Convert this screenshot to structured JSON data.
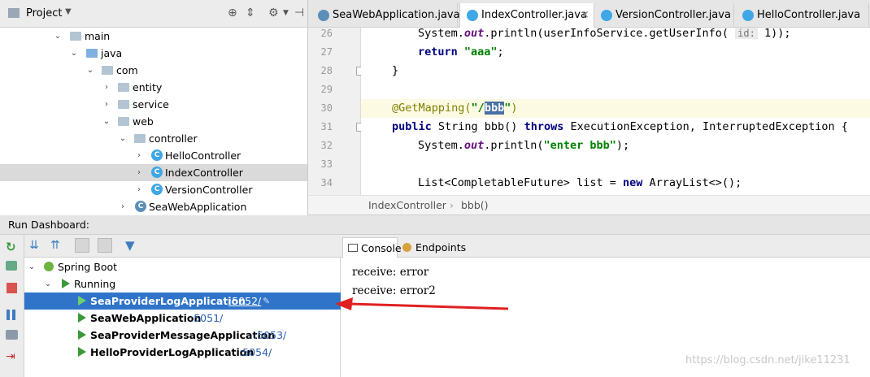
{
  "project": {
    "title": "Project",
    "tree": [
      {
        "label": "main",
        "type": "folder",
        "expanded": true
      },
      {
        "label": "java",
        "type": "folder-blue",
        "expanded": true
      },
      {
        "label": "com",
        "type": "package",
        "expanded": true
      },
      {
        "label": "entity",
        "type": "package",
        "expanded": false
      },
      {
        "label": "service",
        "type": "package",
        "expanded": false
      },
      {
        "label": "web",
        "type": "package",
        "expanded": true
      },
      {
        "label": "controller",
        "type": "package",
        "expanded": true
      },
      {
        "label": "HelloController",
        "type": "class",
        "expanded": false
      },
      {
        "label": "IndexController",
        "type": "class",
        "expanded": false,
        "selected": true
      },
      {
        "label": "VersionController",
        "type": "class",
        "expanded": false
      },
      {
        "label": "SeaWebApplication",
        "type": "spring-class",
        "expanded": false
      }
    ]
  },
  "tabs": [
    {
      "label": "SeaWebApplication.java",
      "active": false
    },
    {
      "label": "IndexController.java",
      "active": true
    },
    {
      "label": "VersionController.java",
      "active": false
    },
    {
      "label": "HelloController.java",
      "active": false
    }
  ],
  "editor": {
    "lines": [
      {
        "num": "26"
      },
      {
        "num": "27"
      },
      {
        "num": "28"
      },
      {
        "num": "29"
      },
      {
        "num": "30"
      },
      {
        "num": "31"
      },
      {
        "num": "32"
      },
      {
        "num": "33"
      },
      {
        "num": "34"
      }
    ],
    "code": {
      "l26a": "System.",
      "l26b": "out",
      "l26c": ".println(userInfoService.getUserInfo( ",
      "l26hint": "id:",
      "l26d": " 1));",
      "l27kw": "return ",
      "l27str": "\"aaa\"",
      "l27end": ";",
      "l28": "}",
      "l30ann": "@GetMapping(",
      "l30q1": "\"/",
      "l30sel": "bbb",
      "l30q2": "\"",
      ")": ")",
      "l31kw1": "public ",
      "l31a": "String bbb() ",
      "l31kw2": "throws ",
      "l31b": "ExecutionException, InterruptedException {",
      "l32a": "System.",
      "l32b": "out",
      "l32c": ".println(",
      "l32str": "\"enter bbb\"",
      "l32d": ");",
      "l34a": "List<CompletableFuture> list = ",
      "l34kw": "new ",
      "l34b": "ArrayList<>();"
    },
    "breadcrumb": [
      "IndexController",
      "bbb()"
    ]
  },
  "run_dashboard": {
    "title": "Run Dashboard:",
    "group": "Spring Boot",
    "state": "Running",
    "apps": [
      {
        "name": "SeaProviderLogApplication",
        "port": ":5052/",
        "selected": true
      },
      {
        "name": "SeaWebApplication",
        "port": ":5051/",
        "selected": false
      },
      {
        "name": "SeaProviderMessageApplication",
        "port": ":5053/",
        "selected": false
      },
      {
        "name": "HelloProviderLogApplication",
        "port": ":5054/",
        "selected": false
      }
    ]
  },
  "console": {
    "tabs": [
      {
        "label": "Console",
        "active": true
      },
      {
        "label": "Endpoints",
        "active": false
      }
    ],
    "lines": [
      "receive: error",
      "receive: error2"
    ]
  },
  "watermark": "https://blog.csdn.net/jike11231",
  "colors": {
    "selection": "#2f74c9",
    "arrow": "#e02020",
    "run": "#3a9a3a"
  }
}
